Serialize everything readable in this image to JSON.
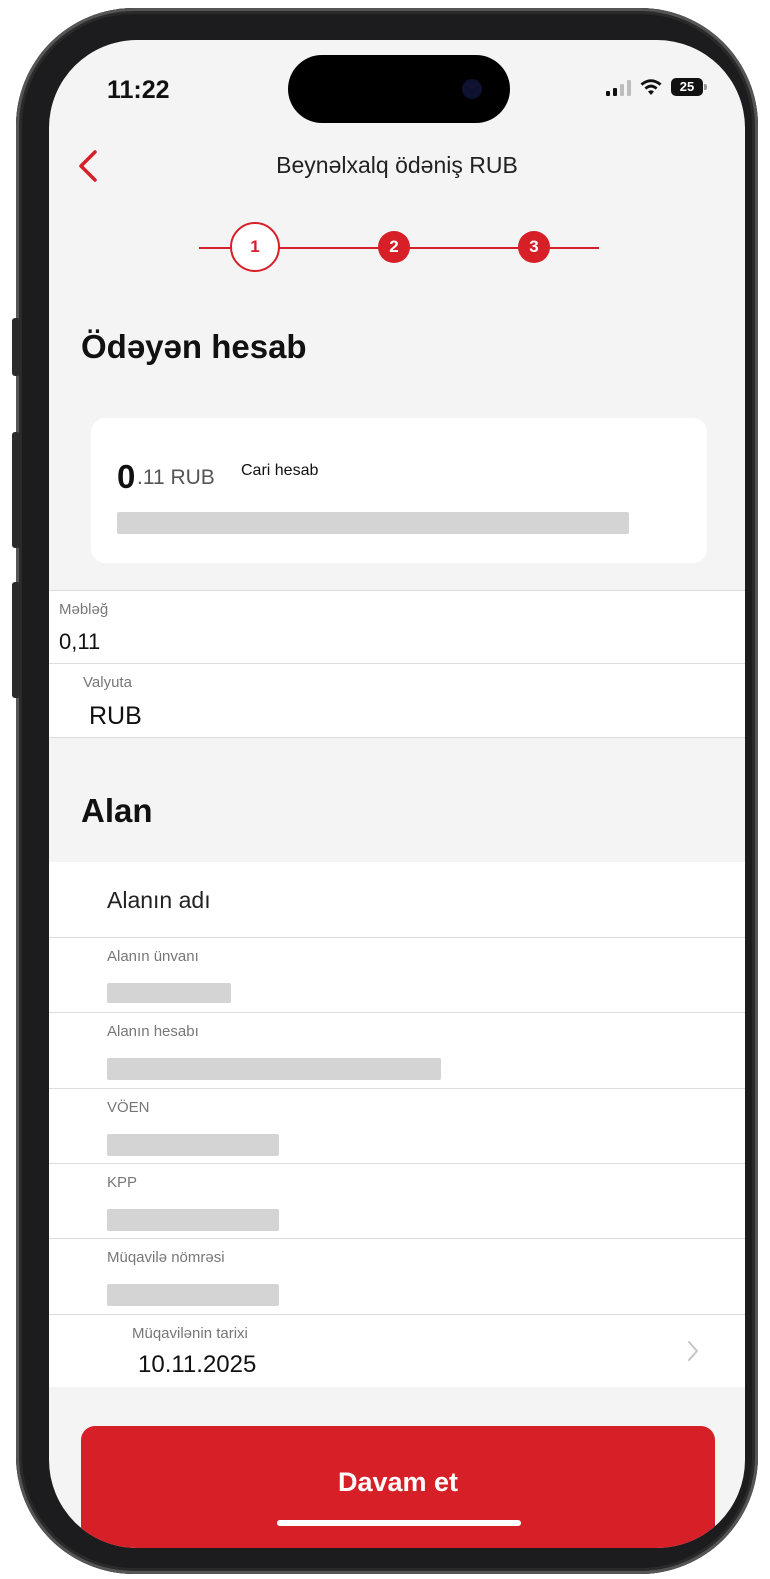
{
  "status": {
    "time": "11:22",
    "battery": "25"
  },
  "nav": {
    "back_icon": "chevron-left-icon",
    "title": "Beynəlxalq ödəniş RUB"
  },
  "steps": [
    {
      "num": "1",
      "state": "current"
    },
    {
      "num": "2",
      "state": "pending"
    },
    {
      "num": "3",
      "state": "pending"
    }
  ],
  "payer": {
    "heading": "Ödəyən hesab",
    "account": {
      "amount_int": "0",
      "amount_frac": ".11 RUB",
      "type": "Cari hesab"
    },
    "amount": {
      "label": "Məbləğ",
      "value": "0,11"
    },
    "currency": {
      "label": "Valyuta",
      "value": "RUB"
    }
  },
  "receiver": {
    "heading": "Alan",
    "name_placeholder": "Alanın adı",
    "address": {
      "label": "Alanın ünvanı",
      "value": ""
    },
    "account": {
      "label": "Alanın hesabı",
      "value": ""
    },
    "voen": {
      "label": "VÖEN",
      "value": ""
    },
    "kpp": {
      "label": "KPP",
      "value": ""
    },
    "contract_no": {
      "label": "Müqavilə nömrəsi",
      "value": ""
    },
    "contract_date": {
      "label": "Müqavilənin tarixi",
      "value": "10.11.2025"
    }
  },
  "cta": {
    "label": "Davam et"
  },
  "colors": {
    "accent": "#d71f27",
    "background": "#f4f4f4",
    "card": "#ffffff"
  }
}
